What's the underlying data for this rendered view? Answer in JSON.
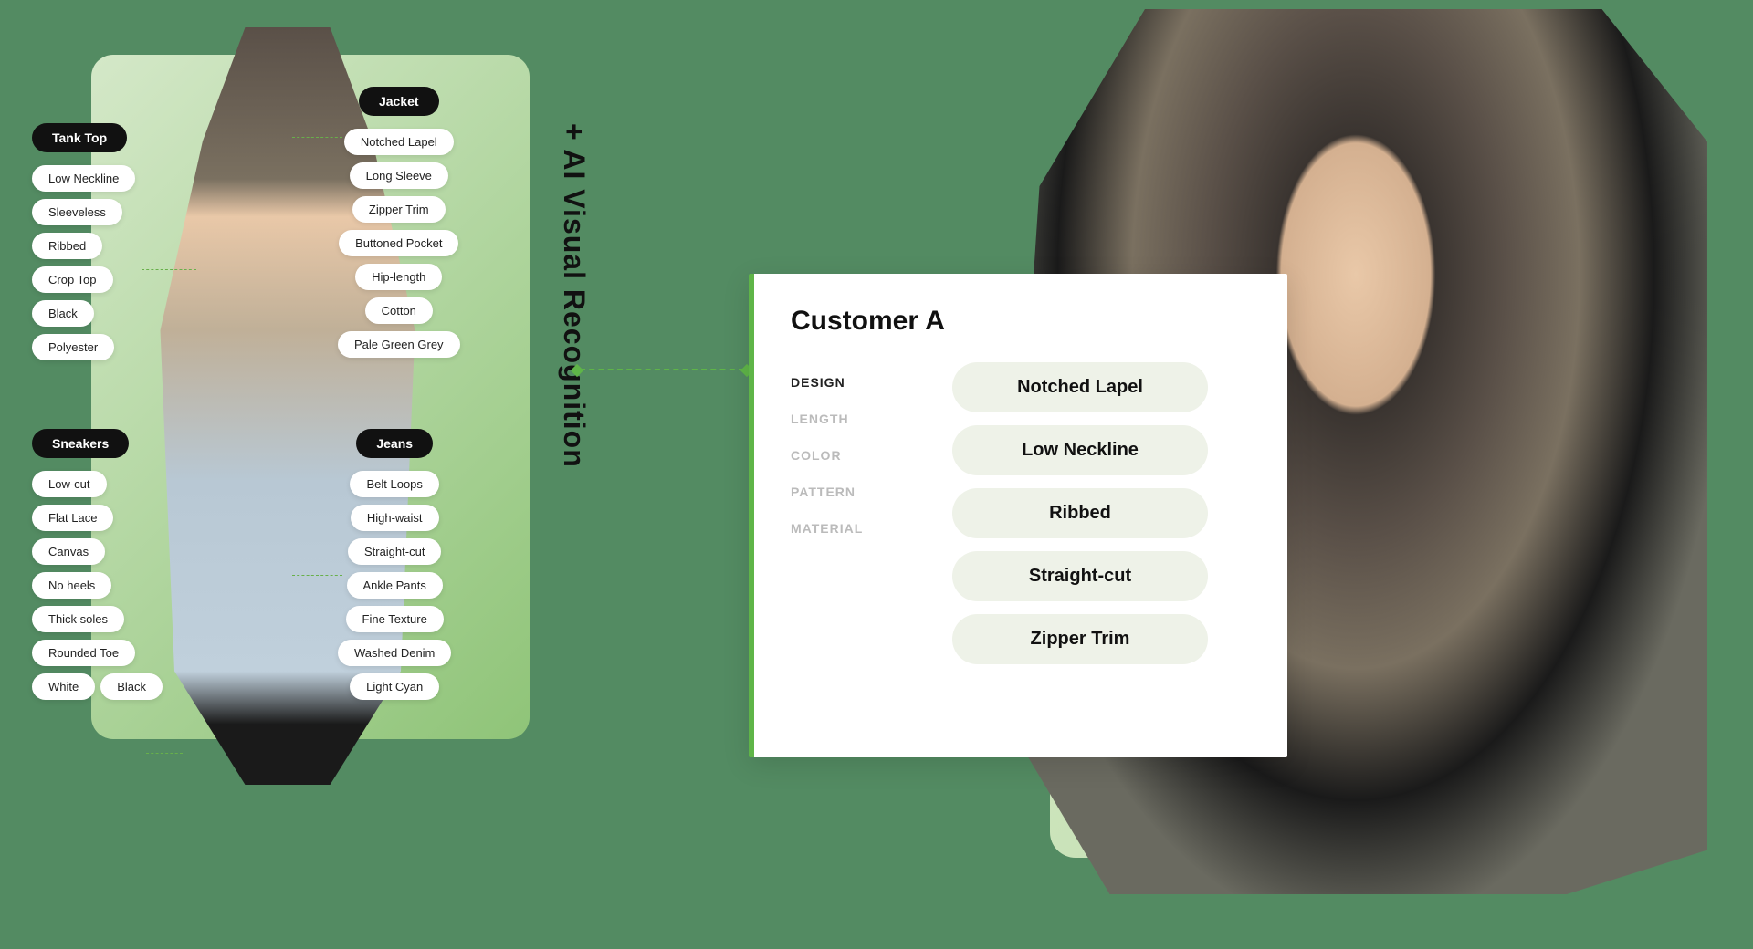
{
  "vertical_label": "+ AI Visual Recognition",
  "groups": {
    "tank_top": {
      "header": "Tank Top",
      "tags": [
        "Low Neckline",
        "Sleeveless",
        "Ribbed",
        "Crop Top",
        "Black",
        "Polyester"
      ]
    },
    "jacket": {
      "header": "Jacket",
      "tags": [
        "Notched Lapel",
        "Long Sleeve",
        "Zipper Trim",
        "Buttoned Pocket",
        "Hip-length",
        "Cotton",
        "Pale Green Grey"
      ]
    },
    "sneakers": {
      "header": "Sneakers",
      "tags": [
        "Low-cut",
        "Flat Lace",
        "Canvas",
        "No heels",
        "Thick soles",
        "Rounded Toe"
      ],
      "tag_row": [
        "White",
        "Black"
      ]
    },
    "jeans": {
      "header": "Jeans",
      "tags": [
        "Belt Loops",
        "High-waist",
        "Straight-cut",
        "Ankle Pants",
        "Fine Texture",
        "Washed Denim",
        "Light Cyan"
      ]
    }
  },
  "customer": {
    "title": "Customer A",
    "labels": [
      "DESIGN",
      "LENGTH",
      "COLOR",
      "PATTERN",
      "MATERIAL"
    ],
    "values": [
      "Notched Lapel",
      "Low Neckline",
      "Ribbed",
      "Straight-cut",
      "Zipper Trim"
    ]
  }
}
